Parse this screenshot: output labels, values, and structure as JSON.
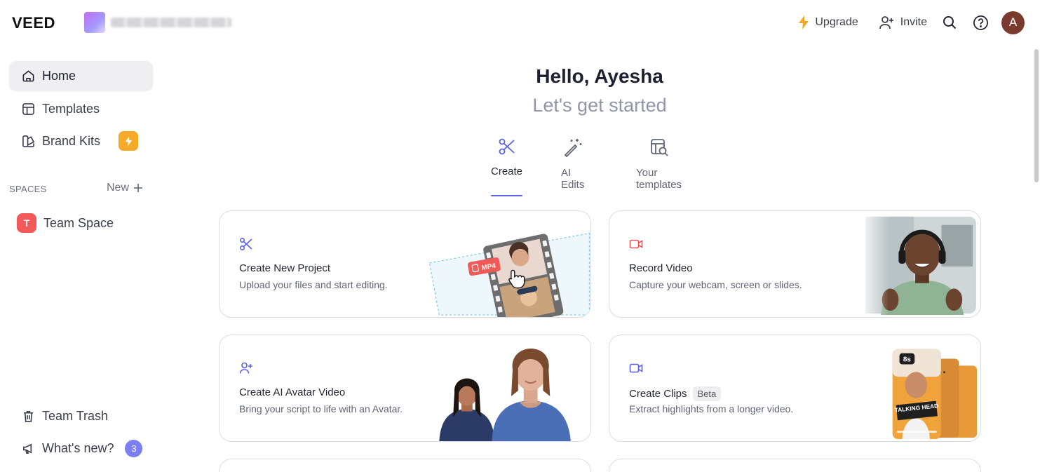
{
  "brand": {
    "logo_text": "VEED"
  },
  "topbar": {
    "upgrade_label": "Upgrade",
    "invite_label": "Invite",
    "avatar_initial": "A"
  },
  "sidebar": {
    "items": [
      {
        "label": "Home"
      },
      {
        "label": "Templates"
      },
      {
        "label": "Brand Kits"
      }
    ],
    "spaces_label": "SPACES",
    "new_label": "New",
    "team_space": {
      "badge": "T",
      "label": "Team Space"
    },
    "bottom": {
      "trash_label": "Team Trash",
      "whats_new_label": "What's new?",
      "whats_new_count": "3"
    }
  },
  "main": {
    "greeting": "Hello, Ayesha",
    "subtitle": "Let's get started",
    "tabs": [
      {
        "label": "Create"
      },
      {
        "label": "AI Edits"
      },
      {
        "label": "Your templates"
      }
    ],
    "cards": [
      {
        "title": "Create New Project",
        "desc": "Upload your files and start editing.",
        "badge": "MP4"
      },
      {
        "title": "Record Video",
        "desc": "Capture your webcam, screen or slides."
      },
      {
        "title": "Create AI Avatar Video",
        "desc": "Bring your script to life with an Avatar."
      },
      {
        "title": "Create Clips",
        "tag": "Beta",
        "desc": "Extract highlights from a longer video.",
        "timer": "8s",
        "caption": "TALKING HEAD"
      }
    ]
  },
  "colors": {
    "accent": "#5b61e6",
    "bolt": "#f7a928",
    "team_badge": "#f25a5a",
    "record_icon": "#ef5350"
  }
}
